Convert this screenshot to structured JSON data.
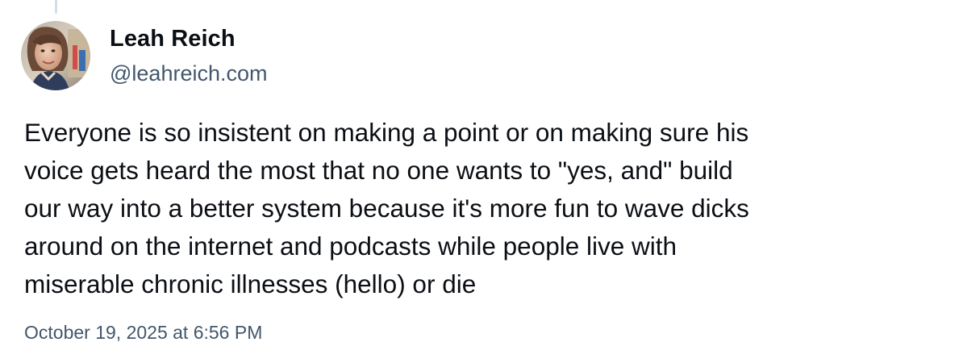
{
  "post": {
    "author": {
      "name": "Leah Reich",
      "handle": "@leahreich.com",
      "avatar_icon": "user-avatar-photo"
    },
    "body_lines": [
      "Everyone is so insistent on making a point or on making sure his",
      "voice gets heard the most that no one wants to \"yes, and\" build",
      "our way into a better system because it's more fun to wave dicks",
      "around on the internet and podcasts while people live with",
      "miserable chronic illnesses (hello) or die"
    ],
    "timestamp": "October 19, 2025 at 6:56 PM"
  },
  "colors": {
    "text_primary": "#0b0f14",
    "text_secondary": "#42576c",
    "thread_line": "#d6dde4",
    "background": "#ffffff"
  }
}
